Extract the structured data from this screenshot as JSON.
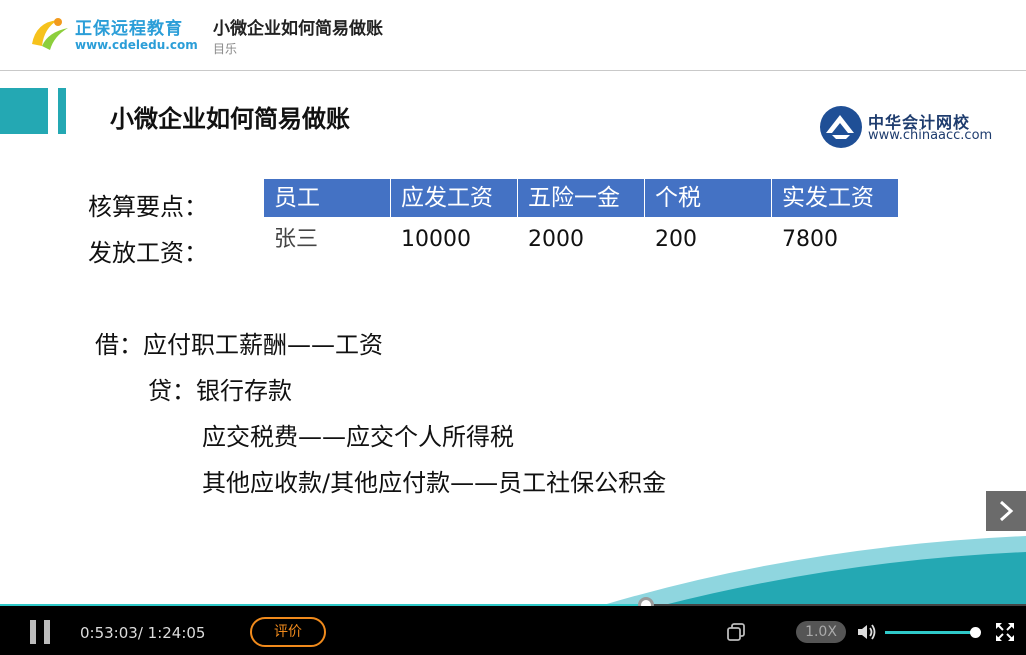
{
  "header": {
    "brand": "正保远程教育",
    "brand_url": "www.cdeledu.com",
    "course_title": "小微企业如何简易做账",
    "course_sub": "目乐"
  },
  "slide": {
    "title": "小微企业如何简易做账",
    "partner_name": "中华会计网校",
    "partner_url": "www.chinaacc.com",
    "label1": "核算要点：",
    "label2": "发放工资：",
    "table": {
      "headers": [
        "员工",
        "应发工资",
        "五险一金",
        "个税",
        "实发工资"
      ],
      "row": [
        "张三",
        "10000",
        "2000",
        "200",
        "7800"
      ]
    },
    "entries": [
      "借：应付职工薪酬——工资",
      "贷：银行存款",
      "应交税费——应交个人所得税",
      "其他应收款/其他应付款——员工社保公积金"
    ]
  },
  "player": {
    "time": "0:53:03/ 1:24:05",
    "rate_label": "评价",
    "speed": "1.0X",
    "progress": 0.63,
    "volume": 0.98,
    "accent": "#2fc9c9"
  }
}
